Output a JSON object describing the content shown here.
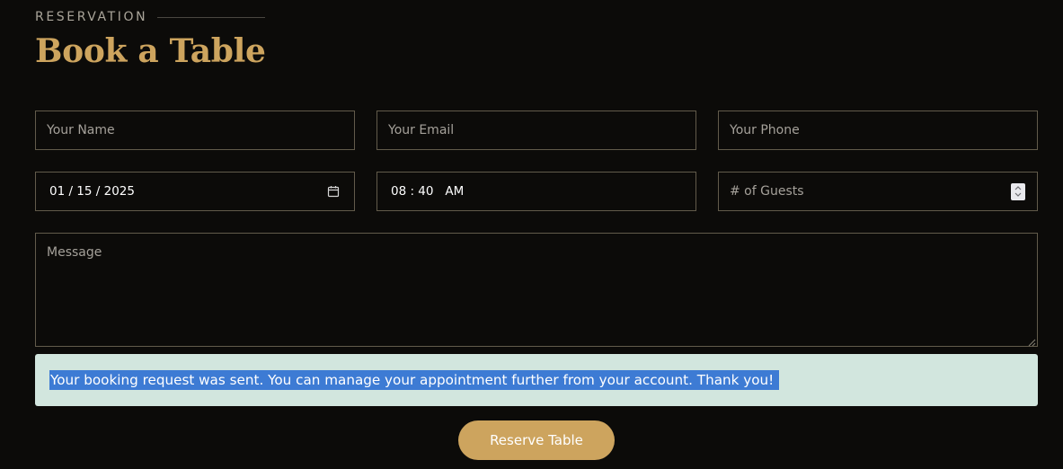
{
  "header": {
    "eyebrow": "RESERVATION",
    "title": "Book a Table"
  },
  "form": {
    "name_placeholder": "Your Name",
    "email_placeholder": "Your Email",
    "phone_placeholder": "Your Phone",
    "date_value": "01 / 15 / 2025",
    "time_value": "08 : 40   AM",
    "guests_placeholder": "# of Guests",
    "message_placeholder": "Message"
  },
  "alert": {
    "text": "Your booking request was sent. You can manage your appointment further from your account. Thank you!"
  },
  "actions": {
    "reserve_label": "Reserve Table"
  },
  "icons": {
    "date": "calendar-icon",
    "guests": "number-spinner-icon",
    "resize": "resize-grip-icon"
  },
  "colors": {
    "background": "#0c0b09",
    "accent": "#cda45e",
    "border": "#625b4b",
    "alert_background": "#d2e6de",
    "selection": "#3d7bd4"
  }
}
